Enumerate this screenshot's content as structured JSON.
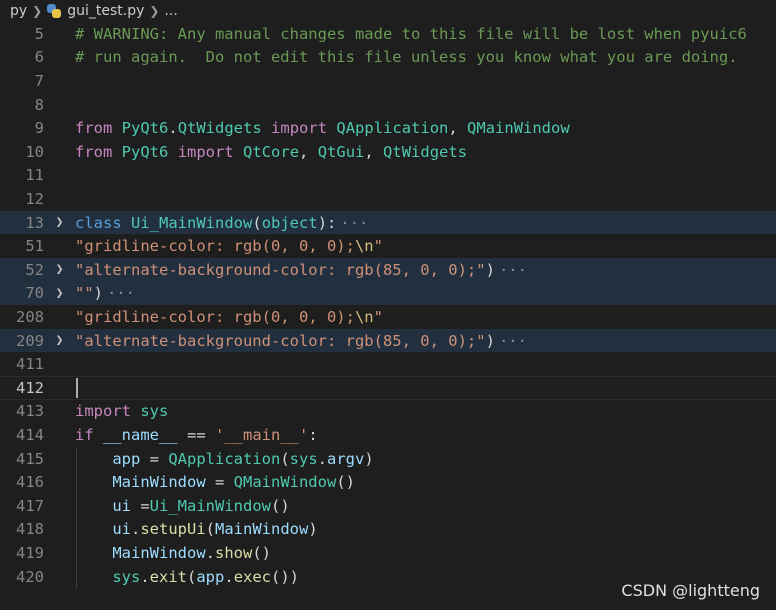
{
  "breadcrumb": {
    "folder": "py",
    "file": "gui_test.py",
    "more": "...",
    "chevron": "chevron-right-icon",
    "file_icon": "python-file-icon"
  },
  "editor": {
    "current_line": "412",
    "lines": {
      "l5": {
        "num": "5",
        "t1": "# WARNING: Any manual changes made to this file will be lost when pyuic6"
      },
      "l6": {
        "num": "6",
        "t1": "# run again.  Do not edit this file unless you know what you are doing."
      },
      "l7": {
        "num": "7"
      },
      "l8": {
        "num": "8"
      },
      "l9": {
        "num": "9",
        "t1": "from",
        "t2": " ",
        "t3": "PyQt6",
        "t4": ".",
        "t5": "QtWidgets",
        "t6": " ",
        "t7": "import",
        "t8": " ",
        "t9": "QApplication",
        "t10": ", ",
        "t11": "QMainWindow"
      },
      "l10": {
        "num": "10",
        "t1": "from",
        "t2": " ",
        "t3": "PyQt6",
        "t4": " ",
        "t5": "import",
        "t6": " ",
        "t7": "QtCore",
        "t8": ", ",
        "t9": "QtGui",
        "t10": ", ",
        "t11": "QtWidgets"
      },
      "l11": {
        "num": "11"
      },
      "l12": {
        "num": "12"
      },
      "l13": {
        "num": "13",
        "t1": "class",
        "t2": " ",
        "t3": "Ui_MainWindow",
        "t4": "(",
        "t5": "object",
        "t6": "):",
        "ell": "···"
      },
      "l51": {
        "num": "51",
        "t1": "\"gridline-color: rgb(0, 0, 0);",
        "t2": "\\n",
        "t3": "\""
      },
      "l52": {
        "num": "52",
        "t1": "\"alternate-background-color: rgb(85, 0, 0);\"",
        "t2": ")",
        "ell": "···"
      },
      "l70": {
        "num": "70",
        "t1": "\"\"",
        "t2": ")",
        "ell": "···"
      },
      "l208": {
        "num": "208",
        "t1": "\"gridline-color: rgb(0, 0, 0);",
        "t2": "\\n",
        "t3": "\""
      },
      "l209": {
        "num": "209",
        "t1": "\"alternate-background-color: rgb(85, 0, 0);\"",
        "t2": ")",
        "ell": "···"
      },
      "l411": {
        "num": "411"
      },
      "l412": {
        "num": "412"
      },
      "l413": {
        "num": "413",
        "t1": "import",
        "t2": " ",
        "t3": "sys"
      },
      "l414": {
        "num": "414",
        "t1": "if",
        "t2": " ",
        "t3": "__name__",
        "t4": " == ",
        "t5": "'__main__'",
        "t6": ":"
      },
      "l415": {
        "num": "415",
        "t0": "    ",
        "t1": "app",
        "t2": " = ",
        "t3": "QApplication",
        "t4": "(",
        "t5": "sys",
        "t6": ".",
        "t7": "argv",
        "t8": ")"
      },
      "l416": {
        "num": "416",
        "t0": "    ",
        "t1": "MainWindow",
        "t2": " = ",
        "t3": "QMainWindow",
        "t4": "()"
      },
      "l417": {
        "num": "417",
        "t0": "    ",
        "t1": "ui",
        "t2": " =",
        "t3": "Ui_MainWindow",
        "t4": "()"
      },
      "l418": {
        "num": "418",
        "t0": "    ",
        "t1": "ui",
        "t2": ".",
        "t3": "setupUi",
        "t4": "(",
        "t5": "MainWindow",
        "t6": ")"
      },
      "l419": {
        "num": "419",
        "t0": "    ",
        "t1": "MainWindow",
        "t2": ".",
        "t3": "show",
        "t4": "()"
      },
      "l420": {
        "num": "420",
        "t0": "    ",
        "t1": "sys",
        "t2": ".",
        "t3": "exit",
        "t4": "(",
        "t5": "app",
        "t6": ".",
        "t7": "exec",
        "t8": "())"
      }
    }
  },
  "watermark": "CSDN @lightteng"
}
